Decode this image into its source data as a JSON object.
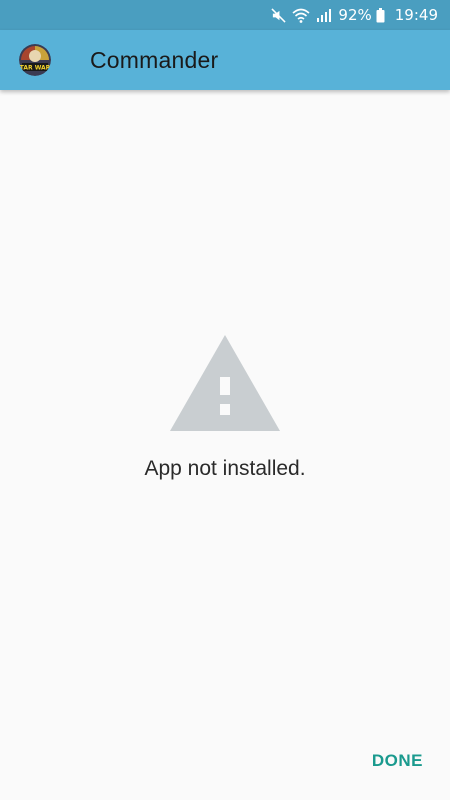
{
  "status_bar": {
    "battery": "92%",
    "time": "19:49",
    "icons": [
      "mute-icon",
      "wifi-icon",
      "signal-icon",
      "battery-icon"
    ]
  },
  "app_bar": {
    "title": "Commander",
    "icon": "app-logo-icon",
    "icon_text": "STAR WARS"
  },
  "content": {
    "warning_icon": "warning-triangle-icon",
    "message": "App not installed."
  },
  "actions": {
    "done_label": "DONE"
  },
  "colors": {
    "status_bar": "#4a9ec0",
    "app_bar": "#58b2d8",
    "background": "#fafafa",
    "warning_icon": "#c9ced1",
    "done_text": "#1a9a8e"
  }
}
